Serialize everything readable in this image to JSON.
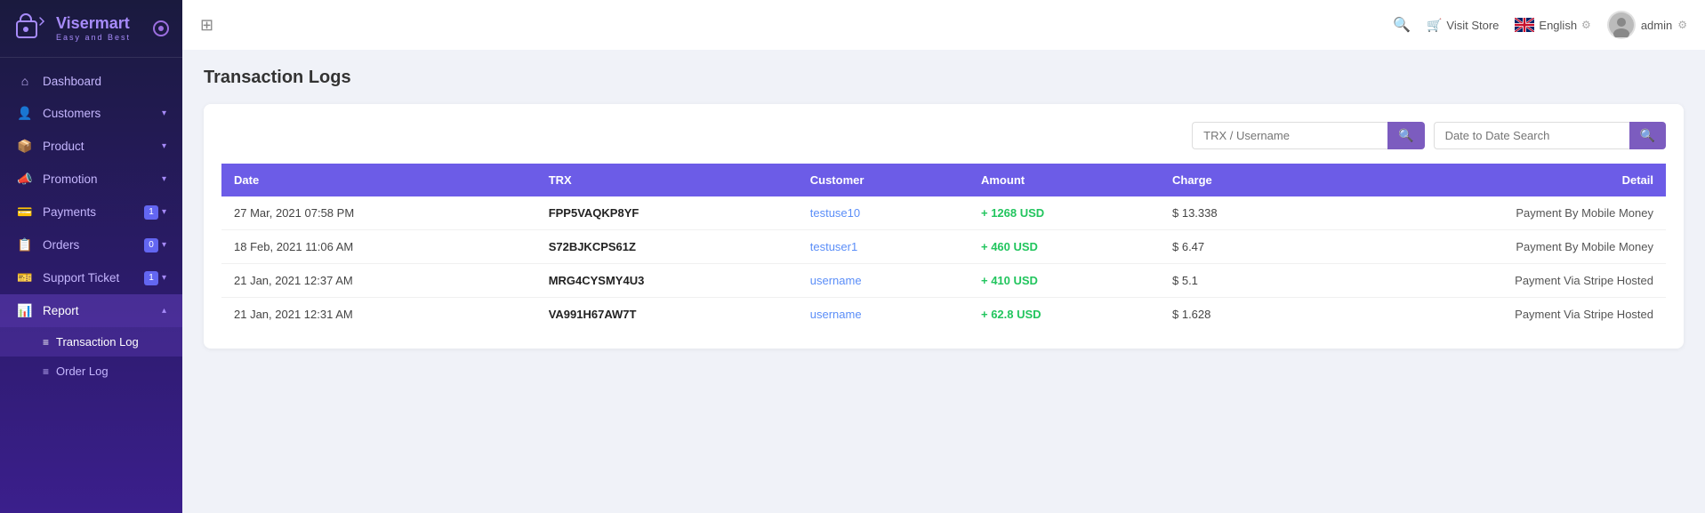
{
  "logo": {
    "name_part1": "Viser",
    "name_part2": "mart",
    "tagline": "Easy and Best"
  },
  "sidebar": {
    "items": [
      {
        "id": "dashboard",
        "label": "Dashboard",
        "icon": "⌂",
        "hasArrow": false,
        "active": false
      },
      {
        "id": "customers",
        "label": "Customers",
        "icon": "👤",
        "hasArrow": true,
        "active": false
      },
      {
        "id": "product",
        "label": "Product",
        "icon": "📦",
        "hasArrow": true,
        "active": false
      },
      {
        "id": "promotion",
        "label": "Promotion",
        "icon": "📣",
        "hasArrow": true,
        "active": false
      },
      {
        "id": "payments",
        "label": "Payments",
        "icon": "💳",
        "hasArrow": true,
        "active": false,
        "badge": "1"
      },
      {
        "id": "orders",
        "label": "Orders",
        "icon": "📋",
        "hasArrow": true,
        "active": false,
        "badge": "0"
      },
      {
        "id": "support",
        "label": "Support Ticket",
        "icon": "🎫",
        "hasArrow": true,
        "active": false,
        "badge": "1"
      },
      {
        "id": "report",
        "label": "Report",
        "icon": "📊",
        "hasArrow": true,
        "active": true,
        "expanded": true
      }
    ],
    "sub_items": [
      {
        "id": "transaction-log",
        "label": "Transaction Log",
        "active": true
      },
      {
        "id": "order-log",
        "label": "Order Log",
        "active": false
      }
    ]
  },
  "topbar": {
    "visit_store_label": "Visit Store",
    "language": "English",
    "username": "admin"
  },
  "page": {
    "title": "Transaction Logs"
  },
  "search": {
    "trx_placeholder": "TRX / Username",
    "date_placeholder": "Date to Date Search"
  },
  "table": {
    "headers": [
      "Date",
      "TRX",
      "Customer",
      "Amount",
      "Charge",
      "Detail"
    ],
    "rows": [
      {
        "date": "27 Mar, 2021 07:58 PM",
        "trx": "FPP5VAQKP8YF",
        "customer": "testuse10",
        "amount": "+ 1268 USD",
        "charge": "$ 13.338",
        "detail": "Payment By Mobile Money"
      },
      {
        "date": "18 Feb, 2021 11:06 AM",
        "trx": "S72BJKCPS61Z",
        "customer": "testuser1",
        "amount": "+ 460 USD",
        "charge": "$ 6.47",
        "detail": "Payment By Mobile Money"
      },
      {
        "date": "21 Jan, 2021 12:37 AM",
        "trx": "MRG4CYSMY4U3",
        "customer": "username",
        "amount": "+ 410 USD",
        "charge": "$ 5.1",
        "detail": "Payment Via Stripe Hosted"
      },
      {
        "date": "21 Jan, 2021 12:31 AM",
        "trx": "VA991H67AW7T",
        "customer": "username",
        "amount": "+ 62.8 USD",
        "charge": "$ 1.628",
        "detail": "Payment Via Stripe Hosted"
      }
    ]
  }
}
